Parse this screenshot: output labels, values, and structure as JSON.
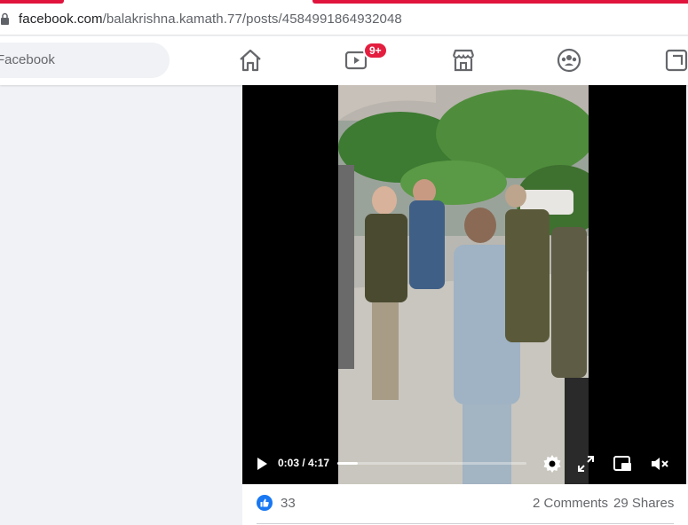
{
  "browser": {
    "url_domain": "facebook.com",
    "url_path": "/balakrishna.kamath.77/posts/4584991864932048"
  },
  "header": {
    "search_placeholder": "Facebook",
    "nav": [
      {
        "icon": "home-icon"
      },
      {
        "icon": "watch-icon",
        "badge": "9+"
      },
      {
        "icon": "marketplace-icon"
      },
      {
        "icon": "groups-icon"
      },
      {
        "icon": "gaming-icon"
      }
    ]
  },
  "video": {
    "time_display": "0:03 / 4:17",
    "progress": 0.0117,
    "controls": [
      "play-icon",
      "settings-icon",
      "fullscreen-icon",
      "picture-in-picture-icon",
      "muted-icon"
    ]
  },
  "post": {
    "reaction_count": "33",
    "comments_label": "2 Comments",
    "shares_label": "29 Shares"
  },
  "colors": {
    "accent": "#1877f2",
    "badge": "#e41e3f",
    "tab_red": "#e0143c"
  }
}
